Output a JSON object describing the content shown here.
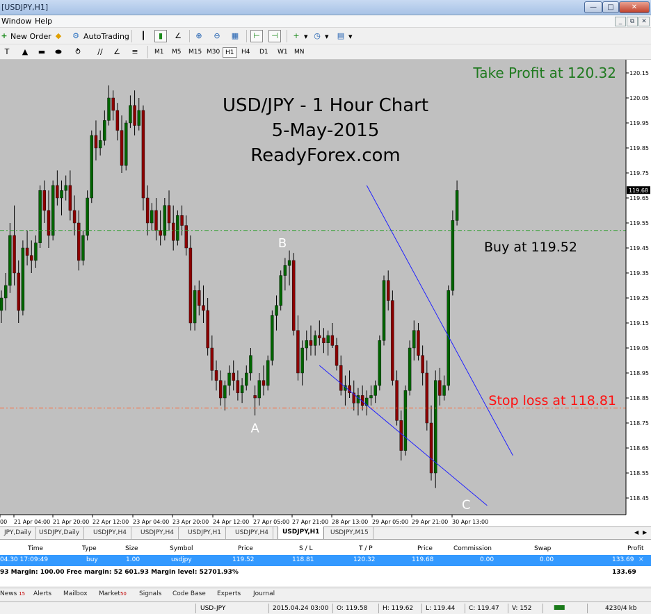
{
  "window": {
    "title": "[USDJPY,H1]"
  },
  "menu": {
    "items": [
      "Window",
      "Help"
    ]
  },
  "toolbar": {
    "new_order": "New Order",
    "autotrading": "AutoTrading",
    "timeframes": [
      "M1",
      "M5",
      "M15",
      "M30",
      "H1",
      "H4",
      "D1",
      "W1",
      "MN"
    ],
    "active_timeframe": "H1"
  },
  "chart": {
    "title_lines": [
      "USD/JPY - 1 Hour Chart",
      "5-May-2015",
      "ReadyForex.com"
    ],
    "annotations": {
      "take_profit": "Take Profit at 120.32",
      "buy": "Buy at 119.52",
      "stop_loss": "Stop loss at 118.81",
      "point_a": "A",
      "point_b": "B",
      "point_c": "C"
    },
    "current_price": "119.68",
    "colors": {
      "background": "#c0c0c0",
      "bull": "#006400",
      "bear": "#8b0000",
      "trendline": "#1f1fff",
      "buy_line": "#2e9e2e",
      "stop_line": "#ff6633",
      "take_profit_text": "#207a20",
      "stop_text": "#ff1010"
    }
  },
  "chart_data": {
    "type": "candlestick",
    "symbol": "USD/JPY",
    "timeframe": "H1",
    "ylim": [
      118.4,
      120.17
    ],
    "y_ticks": [
      "120.15",
      "120.05",
      "119.95",
      "119.85",
      "119.75",
      "119.65",
      "119.55",
      "119.45",
      "119.35",
      "119.25",
      "119.15",
      "119.05",
      "118.95",
      "118.85",
      "118.75",
      "118.65",
      "118.55",
      "118.45"
    ],
    "x_ticks": [
      "00",
      "21 Apr 04:00",
      "21 Apr 20:00",
      "22 Apr 12:00",
      "23 Apr 04:00",
      "23 Apr 20:00",
      "24 Apr 12:00",
      "27 Apr 05:00",
      "27 Apr 21:00",
      "28 Apr 13:00",
      "29 Apr 05:00",
      "29 Apr 21:00",
      "30 Apr 13:00"
    ],
    "levels": {
      "buy": 119.52,
      "stop_loss": 118.81,
      "take_profit": 120.32
    },
    "trendlines": [
      {
        "from": [
          85,
          119.7
        ],
        "to": [
          119,
          118.62
        ]
      },
      {
        "from": [
          74,
          118.98
        ],
        "to": [
          113,
          118.42
        ]
      }
    ],
    "pivots": {
      "A": [
        59,
        118.79
      ],
      "B": [
        67,
        119.43
      ],
      "C": [
        107,
        118.49
      ]
    },
    "candles": [
      [
        119.2,
        119.28,
        119.15,
        119.25
      ],
      [
        119.25,
        119.35,
        119.2,
        119.3
      ],
      [
        119.3,
        119.55,
        119.27,
        119.5
      ],
      [
        119.5,
        119.62,
        119.3,
        119.35
      ],
      [
        119.35,
        119.4,
        119.15,
        119.2
      ],
      [
        119.2,
        119.48,
        119.18,
        119.45
      ],
      [
        119.45,
        119.52,
        119.38,
        119.42
      ],
      [
        119.42,
        119.48,
        119.35,
        119.4
      ],
      [
        119.4,
        119.5,
        119.37,
        119.47
      ],
      [
        119.47,
        119.7,
        119.45,
        119.68
      ],
      [
        119.68,
        119.72,
        119.55,
        119.6
      ],
      [
        119.6,
        119.68,
        119.45,
        119.5
      ],
      [
        119.5,
        119.72,
        119.48,
        119.7
      ],
      [
        119.7,
        119.76,
        119.62,
        119.65
      ],
      [
        119.65,
        119.72,
        119.58,
        119.68
      ],
      [
        119.68,
        119.74,
        119.64,
        119.7
      ],
      [
        119.7,
        119.76,
        119.56,
        119.6
      ],
      [
        119.6,
        119.66,
        119.5,
        119.55
      ],
      [
        119.55,
        119.6,
        119.36,
        119.4
      ],
      [
        119.4,
        119.52,
        119.38,
        119.5
      ],
      [
        119.5,
        119.68,
        119.48,
        119.65
      ],
      [
        119.65,
        119.92,
        119.63,
        119.9
      ],
      [
        119.9,
        119.96,
        119.8,
        119.85
      ],
      [
        119.85,
        119.92,
        119.82,
        119.88
      ],
      [
        119.88,
        120.0,
        119.86,
        119.96
      ],
      [
        119.96,
        120.1,
        119.94,
        120.05
      ],
      [
        120.05,
        120.08,
        119.96,
        120.0
      ],
      [
        120.0,
        120.03,
        119.88,
        119.92
      ],
      [
        119.92,
        119.98,
        119.75,
        119.78
      ],
      [
        119.78,
        119.96,
        119.76,
        119.95
      ],
      [
        119.95,
        120.06,
        119.93,
        120.02
      ],
      [
        120.02,
        120.08,
        119.9,
        119.94
      ],
      [
        119.94,
        120.05,
        119.92,
        120.0
      ],
      [
        120.0,
        120.02,
        119.6,
        119.65
      ],
      [
        119.65,
        119.7,
        119.5,
        119.55
      ],
      [
        119.55,
        119.63,
        119.52,
        119.6
      ],
      [
        119.6,
        119.65,
        119.48,
        119.52
      ],
      [
        119.52,
        119.6,
        119.46,
        119.5
      ],
      [
        119.5,
        119.65,
        119.48,
        119.62
      ],
      [
        119.62,
        119.68,
        119.52,
        119.55
      ],
      [
        119.55,
        119.62,
        119.44,
        119.48
      ],
      [
        119.48,
        119.6,
        119.46,
        119.58
      ],
      [
        119.58,
        119.62,
        119.5,
        119.54
      ],
      [
        119.54,
        119.58,
        119.42,
        119.45
      ],
      [
        119.45,
        119.5,
        119.12,
        119.15
      ],
      [
        119.15,
        119.3,
        119.12,
        119.28
      ],
      [
        119.28,
        119.32,
        119.18,
        119.22
      ],
      [
        119.22,
        119.3,
        119.15,
        119.2
      ],
      [
        119.2,
        119.25,
        119.02,
        119.05
      ],
      [
        119.05,
        119.1,
        118.92,
        118.96
      ],
      [
        118.96,
        119.0,
        118.88,
        118.92
      ],
      [
        118.92,
        118.96,
        118.82,
        118.85
      ],
      [
        118.85,
        118.92,
        118.8,
        118.9
      ],
      [
        118.9,
        118.98,
        118.86,
        118.95
      ],
      [
        118.95,
        119.0,
        118.88,
        118.92
      ],
      [
        118.92,
        118.96,
        118.84,
        118.87
      ],
      [
        118.87,
        118.93,
        118.83,
        118.9
      ],
      [
        118.9,
        118.98,
        118.88,
        118.95
      ],
      [
        118.95,
        119.05,
        118.92,
        119.02
      ],
      [
        118.86,
        118.9,
        118.78,
        118.85
      ],
      [
        118.85,
        118.95,
        118.82,
        118.92
      ],
      [
        118.92,
        118.98,
        118.86,
        118.9
      ],
      [
        118.9,
        119.02,
        118.88,
        119.0
      ],
      [
        119.0,
        119.2,
        118.98,
        119.18
      ],
      [
        119.18,
        119.26,
        119.12,
        119.22
      ],
      [
        119.22,
        119.36,
        119.2,
        119.34
      ],
      [
        119.34,
        119.41,
        119.28,
        119.38
      ],
      [
        119.38,
        119.44,
        119.3,
        119.4
      ],
      [
        119.4,
        119.43,
        119.1,
        119.12
      ],
      [
        119.12,
        119.18,
        118.92,
        118.95
      ],
      [
        118.95,
        119.08,
        118.9,
        119.05
      ],
      [
        119.05,
        119.12,
        119.0,
        119.08
      ],
      [
        119.08,
        119.14,
        119.02,
        119.06
      ],
      [
        119.06,
        119.12,
        119.02,
        119.1
      ],
      [
        119.1,
        119.16,
        119.06,
        119.09
      ],
      [
        119.09,
        119.13,
        119.03,
        119.07
      ],
      [
        119.07,
        119.12,
        119.02,
        119.1
      ],
      [
        119.1,
        119.15,
        119.05,
        119.06
      ],
      [
        119.06,
        119.09,
        118.96,
        118.98
      ],
      [
        118.98,
        119.02,
        118.86,
        118.88
      ],
      [
        118.88,
        118.94,
        118.82,
        118.9
      ],
      [
        118.9,
        118.96,
        118.85,
        118.87
      ],
      [
        118.87,
        118.92,
        118.8,
        118.83
      ],
      [
        118.83,
        118.89,
        118.78,
        118.86
      ],
      [
        118.86,
        118.9,
        118.8,
        118.82
      ],
      [
        118.82,
        118.88,
        118.78,
        118.85
      ],
      [
        118.85,
        118.9,
        118.82,
        118.86
      ],
      [
        118.86,
        118.92,
        118.83,
        118.9
      ],
      [
        118.9,
        119.1,
        118.88,
        119.08
      ],
      [
        119.08,
        119.34,
        119.06,
        119.32
      ],
      [
        119.32,
        119.36,
        119.2,
        119.24
      ],
      [
        119.24,
        119.28,
        118.9,
        118.92
      ],
      [
        118.92,
        118.96,
        118.74,
        118.76
      ],
      [
        118.76,
        118.8,
        118.6,
        118.64
      ],
      [
        118.64,
        118.9,
        118.62,
        118.88
      ],
      [
        118.88,
        119.08,
        118.86,
        119.05
      ],
      [
        119.05,
        119.16,
        119.0,
        119.12
      ],
      [
        119.12,
        119.15,
        119.0,
        119.02
      ],
      [
        119.02,
        119.06,
        118.9,
        118.95
      ],
      [
        118.95,
        119.0,
        118.72,
        118.75
      ],
      [
        118.75,
        118.82,
        118.52,
        118.55
      ],
      [
        118.55,
        118.96,
        118.49,
        118.92
      ],
      [
        118.92,
        118.97,
        118.82,
        118.86
      ],
      [
        118.86,
        118.94,
        118.84,
        118.9
      ],
      [
        118.9,
        119.3,
        118.88,
        119.28
      ],
      [
        119.28,
        119.6,
        119.26,
        119.56
      ],
      [
        119.56,
        119.72,
        119.54,
        119.68
      ]
    ]
  },
  "tabs": {
    "items": [
      "JPY,Daily",
      "USDJPY,Daily",
      "USDJPY,H4",
      "USDJPY,H4",
      "USDJPY,H1",
      "USDJPY,H4",
      "USDJPY,H1",
      "USDJPY,M15"
    ],
    "active": 6
  },
  "terminal": {
    "headers": [
      "Time",
      "Type",
      "Size",
      "Symbol",
      "Price",
      "S / L",
      "T / P",
      "Price",
      "Commission",
      "Swap",
      "Profit"
    ],
    "row": [
      "04.30 17:09:49",
      "buy",
      "1.00",
      "usdjpy",
      "119.52",
      "118.81",
      "120.32",
      "119.68",
      "0.00",
      "0.00",
      "133.69"
    ],
    "summary": "93  Margin: 100.00  Free margin: 52 601.93  Margin level: 52701.93%",
    "summary_profit": "133.69",
    "tabs": [
      {
        "label": "News",
        "badge": "15"
      },
      {
        "label": "Alerts",
        "badge": ""
      },
      {
        "label": "Mailbox",
        "badge": ""
      },
      {
        "label": "Market",
        "badge": "50"
      },
      {
        "label": "Signals",
        "badge": ""
      },
      {
        "label": "Code Base",
        "badge": ""
      },
      {
        "label": "Experts",
        "badge": ""
      },
      {
        "label": "Journal",
        "badge": ""
      }
    ]
  },
  "status": {
    "symbol": "USD-JPY",
    "datetime": "2015.04.24 03:00",
    "open": "O: 119.58",
    "high": "H: 119.62",
    "low": "L: 119.44",
    "close": "C: 119.47",
    "volume": "V: 152",
    "traffic": "4230/4 kb"
  }
}
